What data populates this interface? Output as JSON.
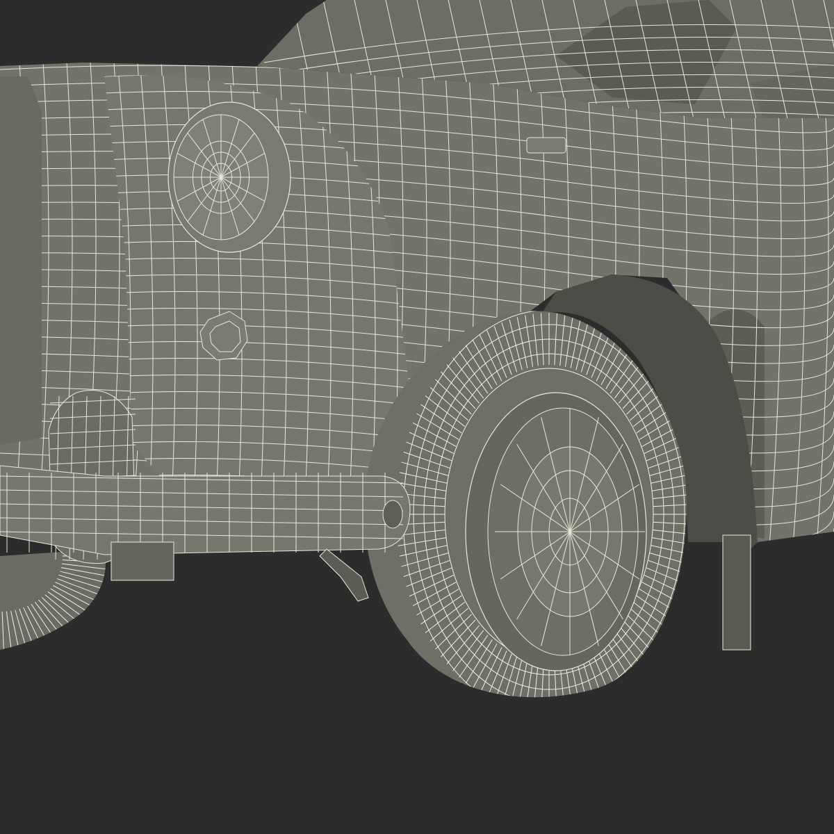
{
  "scene": {
    "subject": "wireframe-car-front-quarter",
    "colors": {
      "background": "#2c2c2c",
      "body_fill": "#73736a",
      "body_shade": "#5d5d55",
      "body_dark": "#4a4a44",
      "wire": "#e8e8da",
      "tire_wire": "#f2f2e2"
    }
  }
}
